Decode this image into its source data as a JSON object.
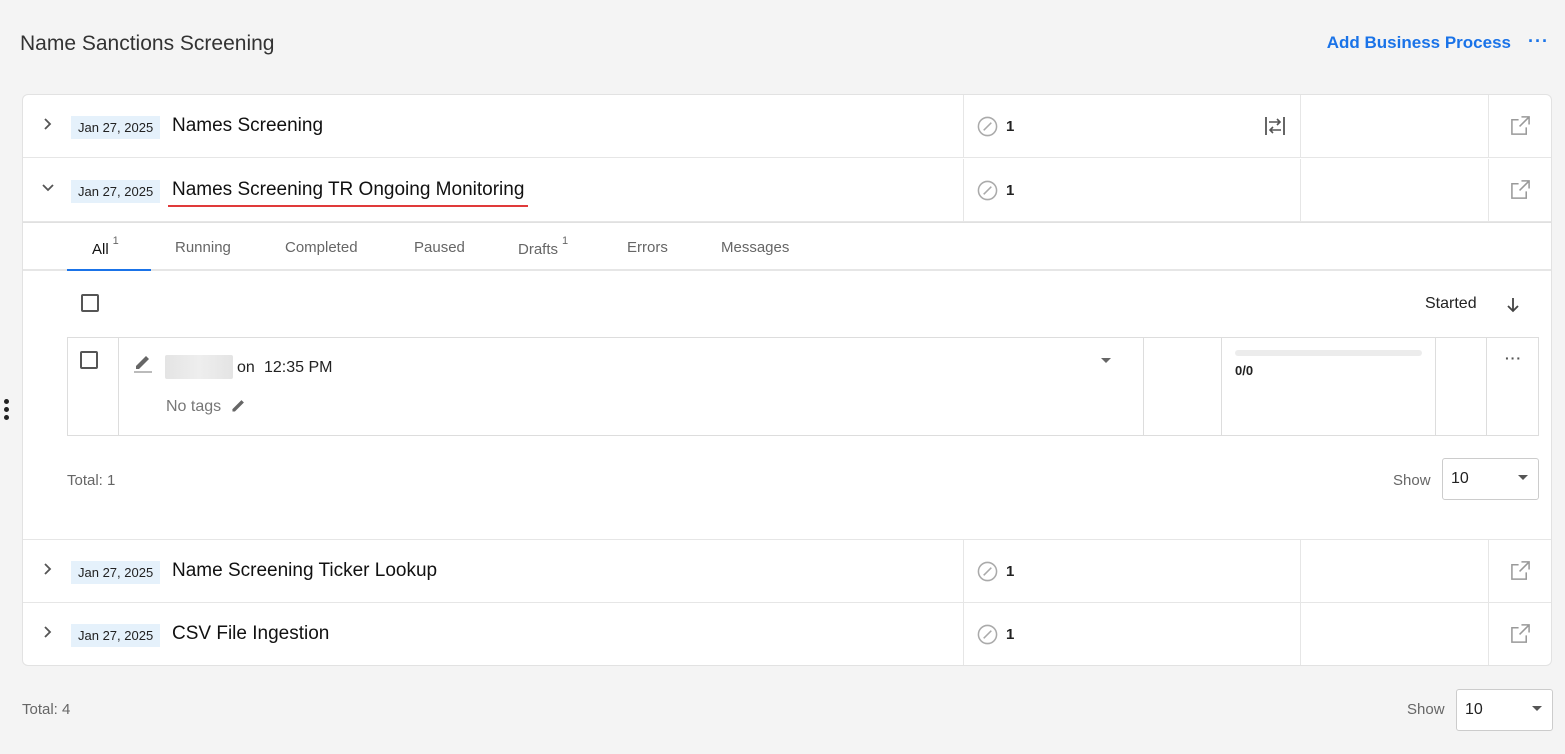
{
  "header": {
    "title": "Name Sanctions Screening",
    "add_business_process": "Add Business Process",
    "more": "···"
  },
  "processes": [
    {
      "date": "Jan 27, 2025",
      "name": "Names Screening",
      "count": "1",
      "expanded": false
    },
    {
      "date": "Jan 27, 2025",
      "name": "Names Screening TR Ongoing Monitoring",
      "count": "1",
      "expanded": true
    },
    {
      "date": "Jan 27, 2025",
      "name": "Name Screening Ticker Lookup",
      "count": "1",
      "expanded": false
    },
    {
      "date": "Jan 27, 2025",
      "name": "CSV File Ingestion",
      "count": "1",
      "expanded": false
    }
  ],
  "tabs": [
    {
      "label": "All",
      "badge": "1",
      "active": true
    },
    {
      "label": "Running",
      "badge": ""
    },
    {
      "label": "Completed",
      "badge": ""
    },
    {
      "label": "Paused",
      "badge": ""
    },
    {
      "label": "Drafts",
      "badge": "1"
    },
    {
      "label": "Errors",
      "badge": ""
    },
    {
      "label": "Messages",
      "badge": ""
    }
  ],
  "sort": {
    "label": "Started"
  },
  "instance": {
    "on_label": "on",
    "time": "12:35 PM",
    "tags": "No tags",
    "progress_text": "0/0",
    "progress_value": 0,
    "more": "···"
  },
  "inner_footer": {
    "total": "Total: 1",
    "show_label": "Show",
    "page_size": "10"
  },
  "outer_footer": {
    "total": "Total: 4",
    "show_label": "Show",
    "page_size": "10"
  },
  "colors": {
    "accent": "#1a73e8",
    "highlight_underline": "#e03a3a",
    "date_badge_bg": "#e5f1fb"
  }
}
